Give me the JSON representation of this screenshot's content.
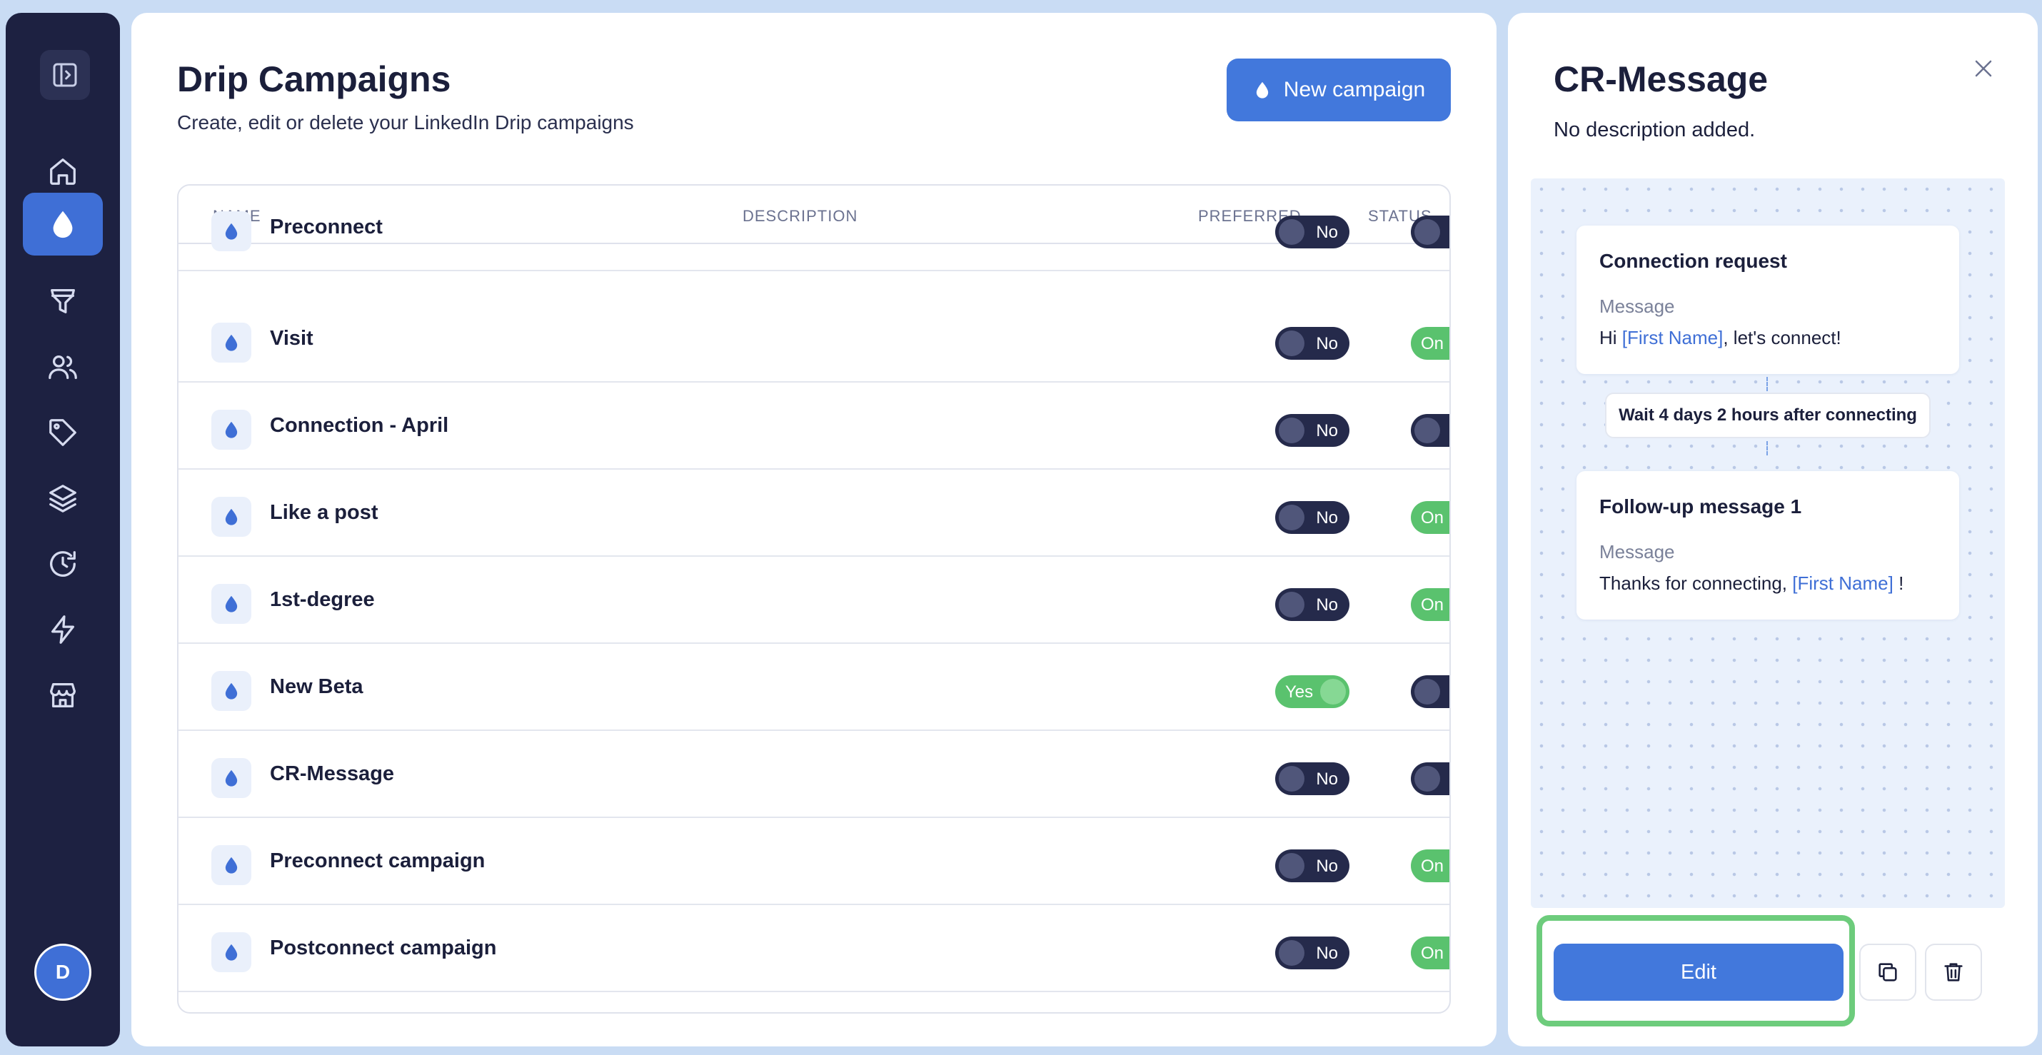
{
  "sidebar": {
    "avatar_initial": "D",
    "items": [
      {
        "name": "home",
        "icon": "home-icon",
        "active": false
      },
      {
        "name": "drip-campaigns",
        "icon": "droplet-icon",
        "active": true
      },
      {
        "name": "funnel",
        "icon": "funnel-icon",
        "active": false
      },
      {
        "name": "people",
        "icon": "users-icon",
        "active": false
      },
      {
        "name": "tags",
        "icon": "tag-icon",
        "active": false
      },
      {
        "name": "layers",
        "icon": "layers-icon",
        "active": false
      },
      {
        "name": "history",
        "icon": "history-icon",
        "active": false
      },
      {
        "name": "automations",
        "icon": "lightning-icon",
        "active": false
      },
      {
        "name": "store",
        "icon": "store-icon",
        "active": false
      }
    ]
  },
  "main": {
    "title": "Drip Campaigns",
    "subtitle": "Create, edit or delete your LinkedIn Drip campaigns",
    "new_button_label": "New campaign",
    "columns": {
      "name": "NAME",
      "description": "DESCRIPTION",
      "preferred": "PREFERRED",
      "status": "STATUS"
    },
    "rows": [
      {
        "name": "Preconnect",
        "preferred": "No",
        "preferred_on": false,
        "status": "Off",
        "status_on": false
      },
      {
        "name": "Visit",
        "preferred": "No",
        "preferred_on": false,
        "status": "On",
        "status_on": true
      },
      {
        "name": "Connection - April",
        "preferred": "No",
        "preferred_on": false,
        "status": "Off",
        "status_on": false
      },
      {
        "name": "Like a post",
        "preferred": "No",
        "preferred_on": false,
        "status": "On",
        "status_on": true
      },
      {
        "name": "1st-degree",
        "preferred": "No",
        "preferred_on": false,
        "status": "On",
        "status_on": true
      },
      {
        "name": "New Beta",
        "preferred": "Yes",
        "preferred_on": true,
        "status": "Off",
        "status_on": false
      },
      {
        "name": "CR-Message",
        "preferred": "No",
        "preferred_on": false,
        "status": "Off",
        "status_on": false
      },
      {
        "name": "Preconnect campaign",
        "preferred": "No",
        "preferred_on": false,
        "status": "On",
        "status_on": true
      },
      {
        "name": "Postconnect campaign",
        "preferred": "No",
        "preferred_on": false,
        "status": "On",
        "status_on": true
      }
    ]
  },
  "panel": {
    "title": "CR-Message",
    "description": "No description added.",
    "step1": {
      "title": "Connection request",
      "label": "Message",
      "msg_prefix": "Hi ",
      "msg_var": "[First Name]",
      "msg_suffix": ", let's connect!"
    },
    "wait": "Wait 4 days 2 hours after connecting",
    "step2": {
      "title": "Follow-up message 1",
      "label": "Message",
      "msg_prefix": "Thanks for connecting, ",
      "msg_var": "[First Name]",
      "msg_suffix": " !"
    },
    "edit_label": "Edit",
    "highlight_color": "#6dcc7c"
  },
  "colors": {
    "accent": "#4278dc",
    "sidebar_bg": "#1d2141",
    "toggle_on": "#5ac26e",
    "toggle_off": "#252a4b"
  }
}
